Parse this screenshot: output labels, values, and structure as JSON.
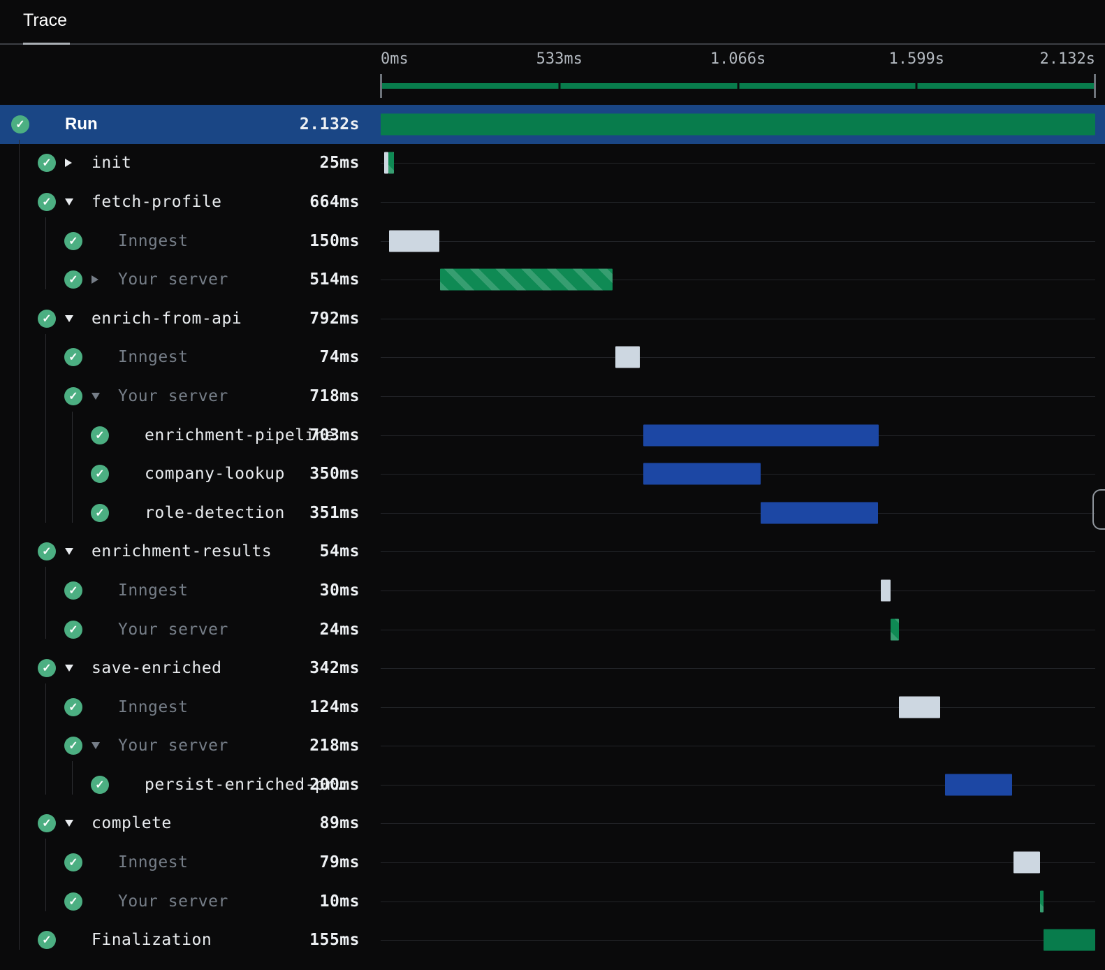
{
  "tab": {
    "title": "Trace"
  },
  "timeline": {
    "total_ms": 2132,
    "axis_ticks": [
      "0ms",
      "533ms",
      "1.066s",
      "1.599s",
      "2.132s"
    ]
  },
  "colors": {
    "background": "#0a0a0b",
    "selected_row_blue": "#1a4685",
    "bar_blue": "#1c47a4",
    "bar_gray": "#cdd7e1",
    "bar_green": "#087c4c",
    "bar_green_hatch": "#0f8a54",
    "success_icon_green": "#4caf82",
    "dim_text": "#767e88",
    "text": "#e9ecef"
  },
  "rows": [
    {
      "label": "Run",
      "duration": "2.132s",
      "level": 0,
      "toggle": "none",
      "dim": false,
      "selected": true,
      "icon": "check-circle",
      "bars": [
        {
          "start": 0,
          "dur": 2132,
          "style": "green_solid"
        }
      ]
    },
    {
      "label": "init",
      "duration": "25ms",
      "level": 1,
      "toggle": "collapsed",
      "dim": false,
      "selected": false,
      "icon": null,
      "bars": [
        {
          "start": 10,
          "dur": 12,
          "style": "gray"
        },
        {
          "start": 22,
          "dur": 18,
          "style": "green_hatch"
        }
      ]
    },
    {
      "label": "fetch-profile",
      "duration": "664ms",
      "level": 1,
      "toggle": "expanded",
      "dim": false,
      "selected": false,
      "icon": null,
      "bars": []
    },
    {
      "label": "Inngest",
      "duration": "150ms",
      "level": 2,
      "toggle": "none",
      "dim": true,
      "selected": false,
      "icon": null,
      "bars": [
        {
          "start": 25,
          "dur": 150,
          "style": "gray"
        }
      ]
    },
    {
      "label": "Your server",
      "duration": "514ms",
      "level": 2,
      "toggle": "collapsed",
      "dim": true,
      "selected": false,
      "icon": null,
      "bars": [
        {
          "start": 177,
          "dur": 514,
          "style": "green_hatch"
        }
      ]
    },
    {
      "label": "enrich-from-api",
      "duration": "792ms",
      "level": 1,
      "toggle": "expanded",
      "dim": false,
      "selected": false,
      "icon": null,
      "bars": []
    },
    {
      "label": "Inngest",
      "duration": "74ms",
      "level": 2,
      "toggle": "none",
      "dim": true,
      "selected": false,
      "icon": null,
      "bars": [
        {
          "start": 700,
          "dur": 74,
          "style": "gray"
        }
      ]
    },
    {
      "label": "Your server",
      "duration": "718ms",
      "level": 2,
      "toggle": "expanded",
      "dim": true,
      "selected": false,
      "icon": null,
      "bars": []
    },
    {
      "label": "enrichment-pipeline",
      "duration": "703ms",
      "level": 3,
      "toggle": "none",
      "dim": false,
      "selected": false,
      "icon": null,
      "bars": [
        {
          "start": 783,
          "dur": 703,
          "style": "blue"
        }
      ]
    },
    {
      "label": "company-lookup",
      "duration": "350ms",
      "level": 3,
      "toggle": "none",
      "dim": false,
      "selected": false,
      "icon": null,
      "bars": [
        {
          "start": 783,
          "dur": 350,
          "style": "blue"
        }
      ]
    },
    {
      "label": "role-detection",
      "duration": "351ms",
      "level": 3,
      "toggle": "none",
      "dim": false,
      "selected": false,
      "icon": null,
      "bars": [
        {
          "start": 1133,
          "dur": 351,
          "style": "blue"
        }
      ]
    },
    {
      "label": "enrichment-results",
      "duration": "54ms",
      "level": 1,
      "toggle": "expanded",
      "dim": false,
      "selected": false,
      "icon": null,
      "bars": []
    },
    {
      "label": "Inngest",
      "duration": "30ms",
      "level": 2,
      "toggle": "none",
      "dim": true,
      "selected": false,
      "icon": null,
      "bars": [
        {
          "start": 1492,
          "dur": 30,
          "style": "gray"
        }
      ]
    },
    {
      "label": "Your server",
      "duration": "24ms",
      "level": 2,
      "toggle": "none",
      "dim": true,
      "selected": false,
      "icon": null,
      "bars": [
        {
          "start": 1522,
          "dur": 24,
          "style": "green_hatch"
        }
      ]
    },
    {
      "label": "save-enriched",
      "duration": "342ms",
      "level": 1,
      "toggle": "expanded",
      "dim": false,
      "selected": false,
      "icon": null,
      "bars": []
    },
    {
      "label": "Inngest",
      "duration": "124ms",
      "level": 2,
      "toggle": "none",
      "dim": true,
      "selected": false,
      "icon": null,
      "bars": [
        {
          "start": 1546,
          "dur": 124,
          "style": "gray"
        }
      ]
    },
    {
      "label": "Your server",
      "duration": "218ms",
      "level": 2,
      "toggle": "expanded",
      "dim": true,
      "selected": false,
      "icon": null,
      "bars": []
    },
    {
      "label": "persist-enriched-pr…",
      "duration": "200ms",
      "level": 3,
      "toggle": "none",
      "dim": false,
      "selected": false,
      "icon": null,
      "bars": [
        {
          "start": 1683,
          "dur": 200,
          "style": "blue"
        }
      ]
    },
    {
      "label": "complete",
      "duration": "89ms",
      "level": 1,
      "toggle": "expanded",
      "dim": false,
      "selected": false,
      "icon": null,
      "bars": []
    },
    {
      "label": "Inngest",
      "duration": "79ms",
      "level": 2,
      "toggle": "none",
      "dim": true,
      "selected": false,
      "icon": null,
      "bars": [
        {
          "start": 1888,
          "dur": 79,
          "style": "gray"
        }
      ]
    },
    {
      "label": "Your server",
      "duration": "10ms",
      "level": 2,
      "toggle": "none",
      "dim": true,
      "selected": false,
      "icon": null,
      "bars": [
        {
          "start": 1967,
          "dur": 10,
          "style": "green_hatch"
        }
      ]
    },
    {
      "label": "Finalization",
      "duration": "155ms",
      "level": 1,
      "toggle": "none",
      "dim": false,
      "selected": false,
      "icon": null,
      "bars": [
        {
          "start": 1977,
          "dur": 155,
          "style": "green_solid"
        }
      ]
    }
  ]
}
